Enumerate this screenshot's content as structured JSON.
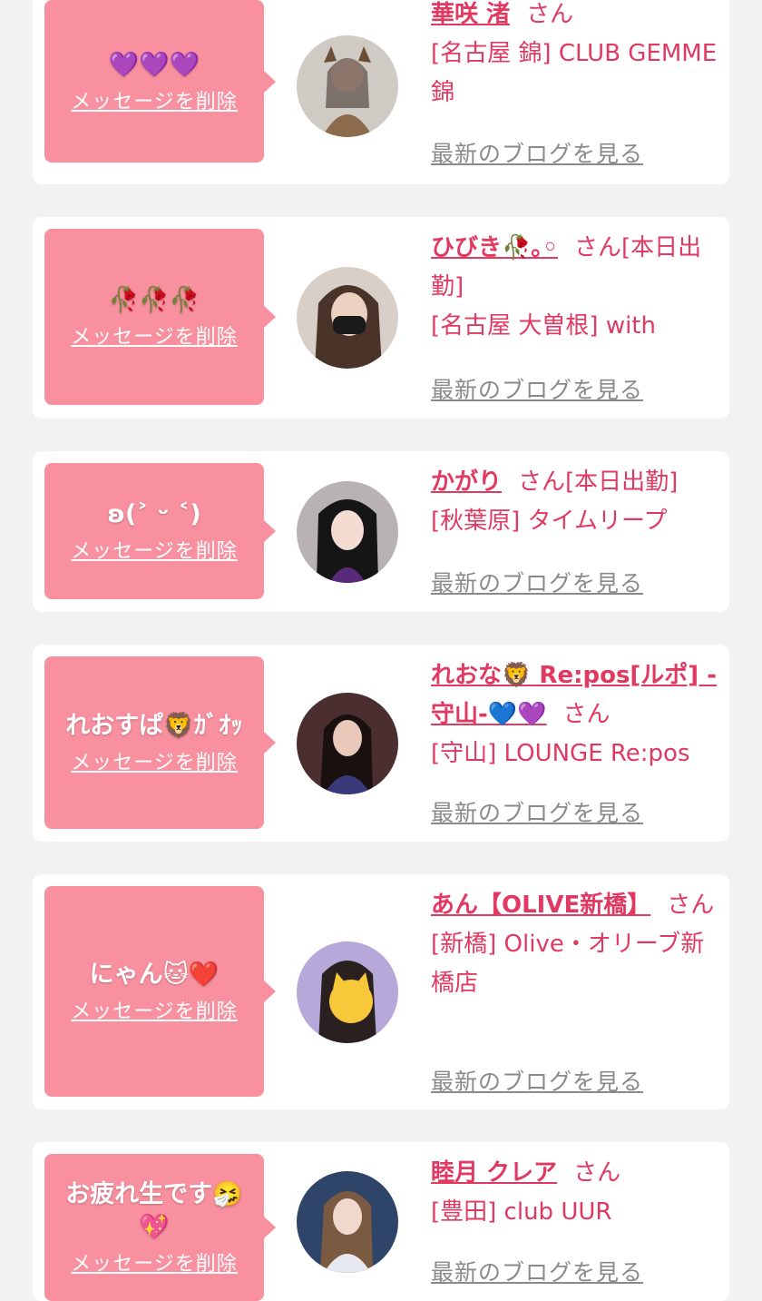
{
  "entries": [
    {
      "stamp": "💜💜💜",
      "delete_label": "メッセージを削除",
      "name": "華咲 渚",
      "suffix": "さん",
      "shop": "[名古屋 錦] CLUB GEMME 錦",
      "blog_label": "最新のブログを見る"
    },
    {
      "stamp": "🥀🥀🥀",
      "delete_label": "メッセージを削除",
      "name": "ひびき🥀｡◦",
      "suffix": "さん[本日出勤]",
      "shop": "[名古屋 大曽根] with",
      "blog_label": "最新のブログを見る"
    },
    {
      "stamp": "ʚ(˃ ᵕ ˂)",
      "delete_label": "メッセージを削除",
      "name": "かがり",
      "suffix": "さん[本日出勤]",
      "shop": "[秋葉原] タイムリープ",
      "blog_label": "最新のブログを見る"
    },
    {
      "stamp": "れおすぱ🦁ｶﾞｵｯ",
      "delete_label": "メッセージを削除",
      "name": "れおな🦁 Re:pos[ルポ] -守山-💙💜",
      "suffix": "さん",
      "shop": "[守山] LOUNGE Re:pos",
      "blog_label": "最新のブログを見る"
    },
    {
      "stamp": "にゃん🐱❤️",
      "delete_label": "メッセージを削除",
      "name": "あん【OLIVE新橋】",
      "suffix": "さん",
      "shop": "[新橋] Olive・オリーブ新橋店",
      "blog_label": "最新のブログを見る"
    },
    {
      "stamp": "お疲れ生です🤧💖",
      "delete_label": "メッセージを削除",
      "name": "睦月 クレア",
      "suffix": "さん",
      "shop": "[豊田] club UUR",
      "blog_label": "最新のブログを見る"
    }
  ],
  "colors": {
    "page_bg": "#f2f2f2",
    "bubble": "#f8909f",
    "accent_text": "#e03a62",
    "muted_link": "#8a8a8a"
  }
}
